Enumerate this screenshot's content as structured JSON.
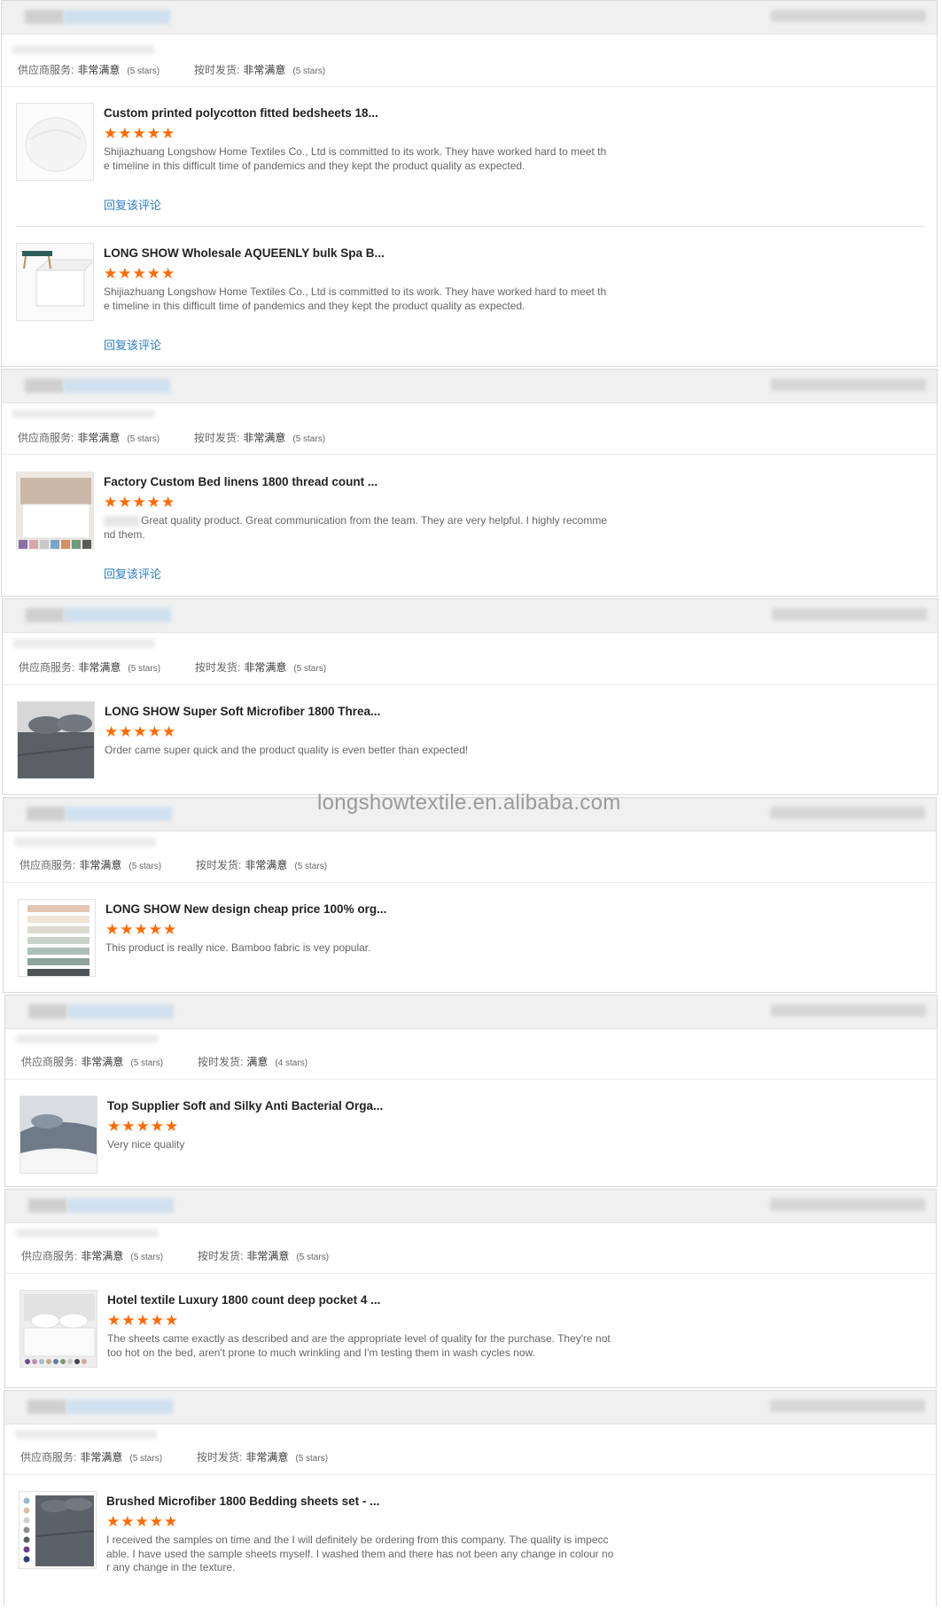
{
  "watermark": "longshowtextile.en.alibaba.com",
  "labels": {
    "service": "供应商服务:",
    "ontime": "按时发货:",
    "reply": "回复该评论"
  },
  "colors": {
    "star": "#ff6a00",
    "reply_link": "#2e7ecb",
    "header_bg": "#f0f0f0"
  },
  "reviews": [
    {
      "service_value": "非常满意",
      "service_stars": "(5 stars)",
      "ontime_value": "非常满意",
      "ontime_stars": "(5 stars)",
      "items": [
        {
          "title": "Custom printed polycotton fitted bedsheets 18...",
          "rating": 5,
          "text": "Shijiazhuang Longshow Home Textiles Co., Ltd is committed to its work. They have worked hard to meet th e timeline in this difficult time of pandemics and they kept the product quality as expected."
        },
        {
          "title": "LONG SHOW Wholesale AQUEENLY bulk Spa B...",
          "rating": 5,
          "text": "Shijiazhuang Longshow Home Textiles Co., Ltd is committed to its work. They have worked hard to meet th e timeline in this difficult time of pandemics and they kept the product quality as expected."
        }
      ]
    },
    {
      "service_value": "非常满意",
      "service_stars": "(5 stars)",
      "ontime_value": "非常满意",
      "ontime_stars": "(5 stars)",
      "items": [
        {
          "title": "Factory Custom Bed linens 1800 thread count ...",
          "rating": 5,
          "text": "Great quality product. Great communication from the team. They are very helpful. I highly recomme nd them."
        }
      ]
    },
    {
      "service_value": "非常满意",
      "service_stars": "(5 stars)",
      "ontime_value": "非常满意",
      "ontime_stars": "(5 stars)",
      "items": [
        {
          "title": "LONG SHOW Super Soft Microfiber 1800 Threa...",
          "rating": 5,
          "text": "Order came super quick and the product quality is even better than expected!"
        }
      ]
    },
    {
      "service_value": "非常满意",
      "service_stars": "(5 stars)",
      "ontime_value": "非常满意",
      "ontime_stars": "(5 stars)",
      "items": [
        {
          "title": "LONG SHOW New design cheap price 100% org...",
          "rating": 5,
          "text": "This product is really nice. Bamboo fabric is vey popular."
        }
      ]
    },
    {
      "service_value": "非常满意",
      "service_stars": "(5 stars)",
      "ontime_value": "满意",
      "ontime_stars": "(4 stars)",
      "items": [
        {
          "title": "Top Supplier Soft and Silky Anti Bacterial Orga...",
          "rating": 5,
          "text": "Very nice quality"
        }
      ]
    },
    {
      "service_value": "非常满意",
      "service_stars": "(5 stars)",
      "ontime_value": "非常满意",
      "ontime_stars": "(5 stars)",
      "items": [
        {
          "title": "Hotel textile Luxury 1800 count deep pocket 4 ...",
          "rating": 5,
          "text": "The sheets came exactly as described and are the appropriate level of quality for the purchase.  They're not too hot on the bed, aren't prone to much wrinkling and I'm testing them in wash cycles now."
        }
      ]
    },
    {
      "service_value": "非常满意",
      "service_stars": "(5 stars)",
      "ontime_value": "非常满意",
      "ontime_stars": "(5 stars)",
      "items": [
        {
          "title": "Brushed Microfiber 1800 Bedding sheets set - ...",
          "rating": 5,
          "text": "I received the samples on time and the I will definitely be ordering from this company. The quality is impecc able. I have used the sample sheets myself. I washed them and there has not been any change in colour no r any change in the texture."
        }
      ]
    }
  ]
}
